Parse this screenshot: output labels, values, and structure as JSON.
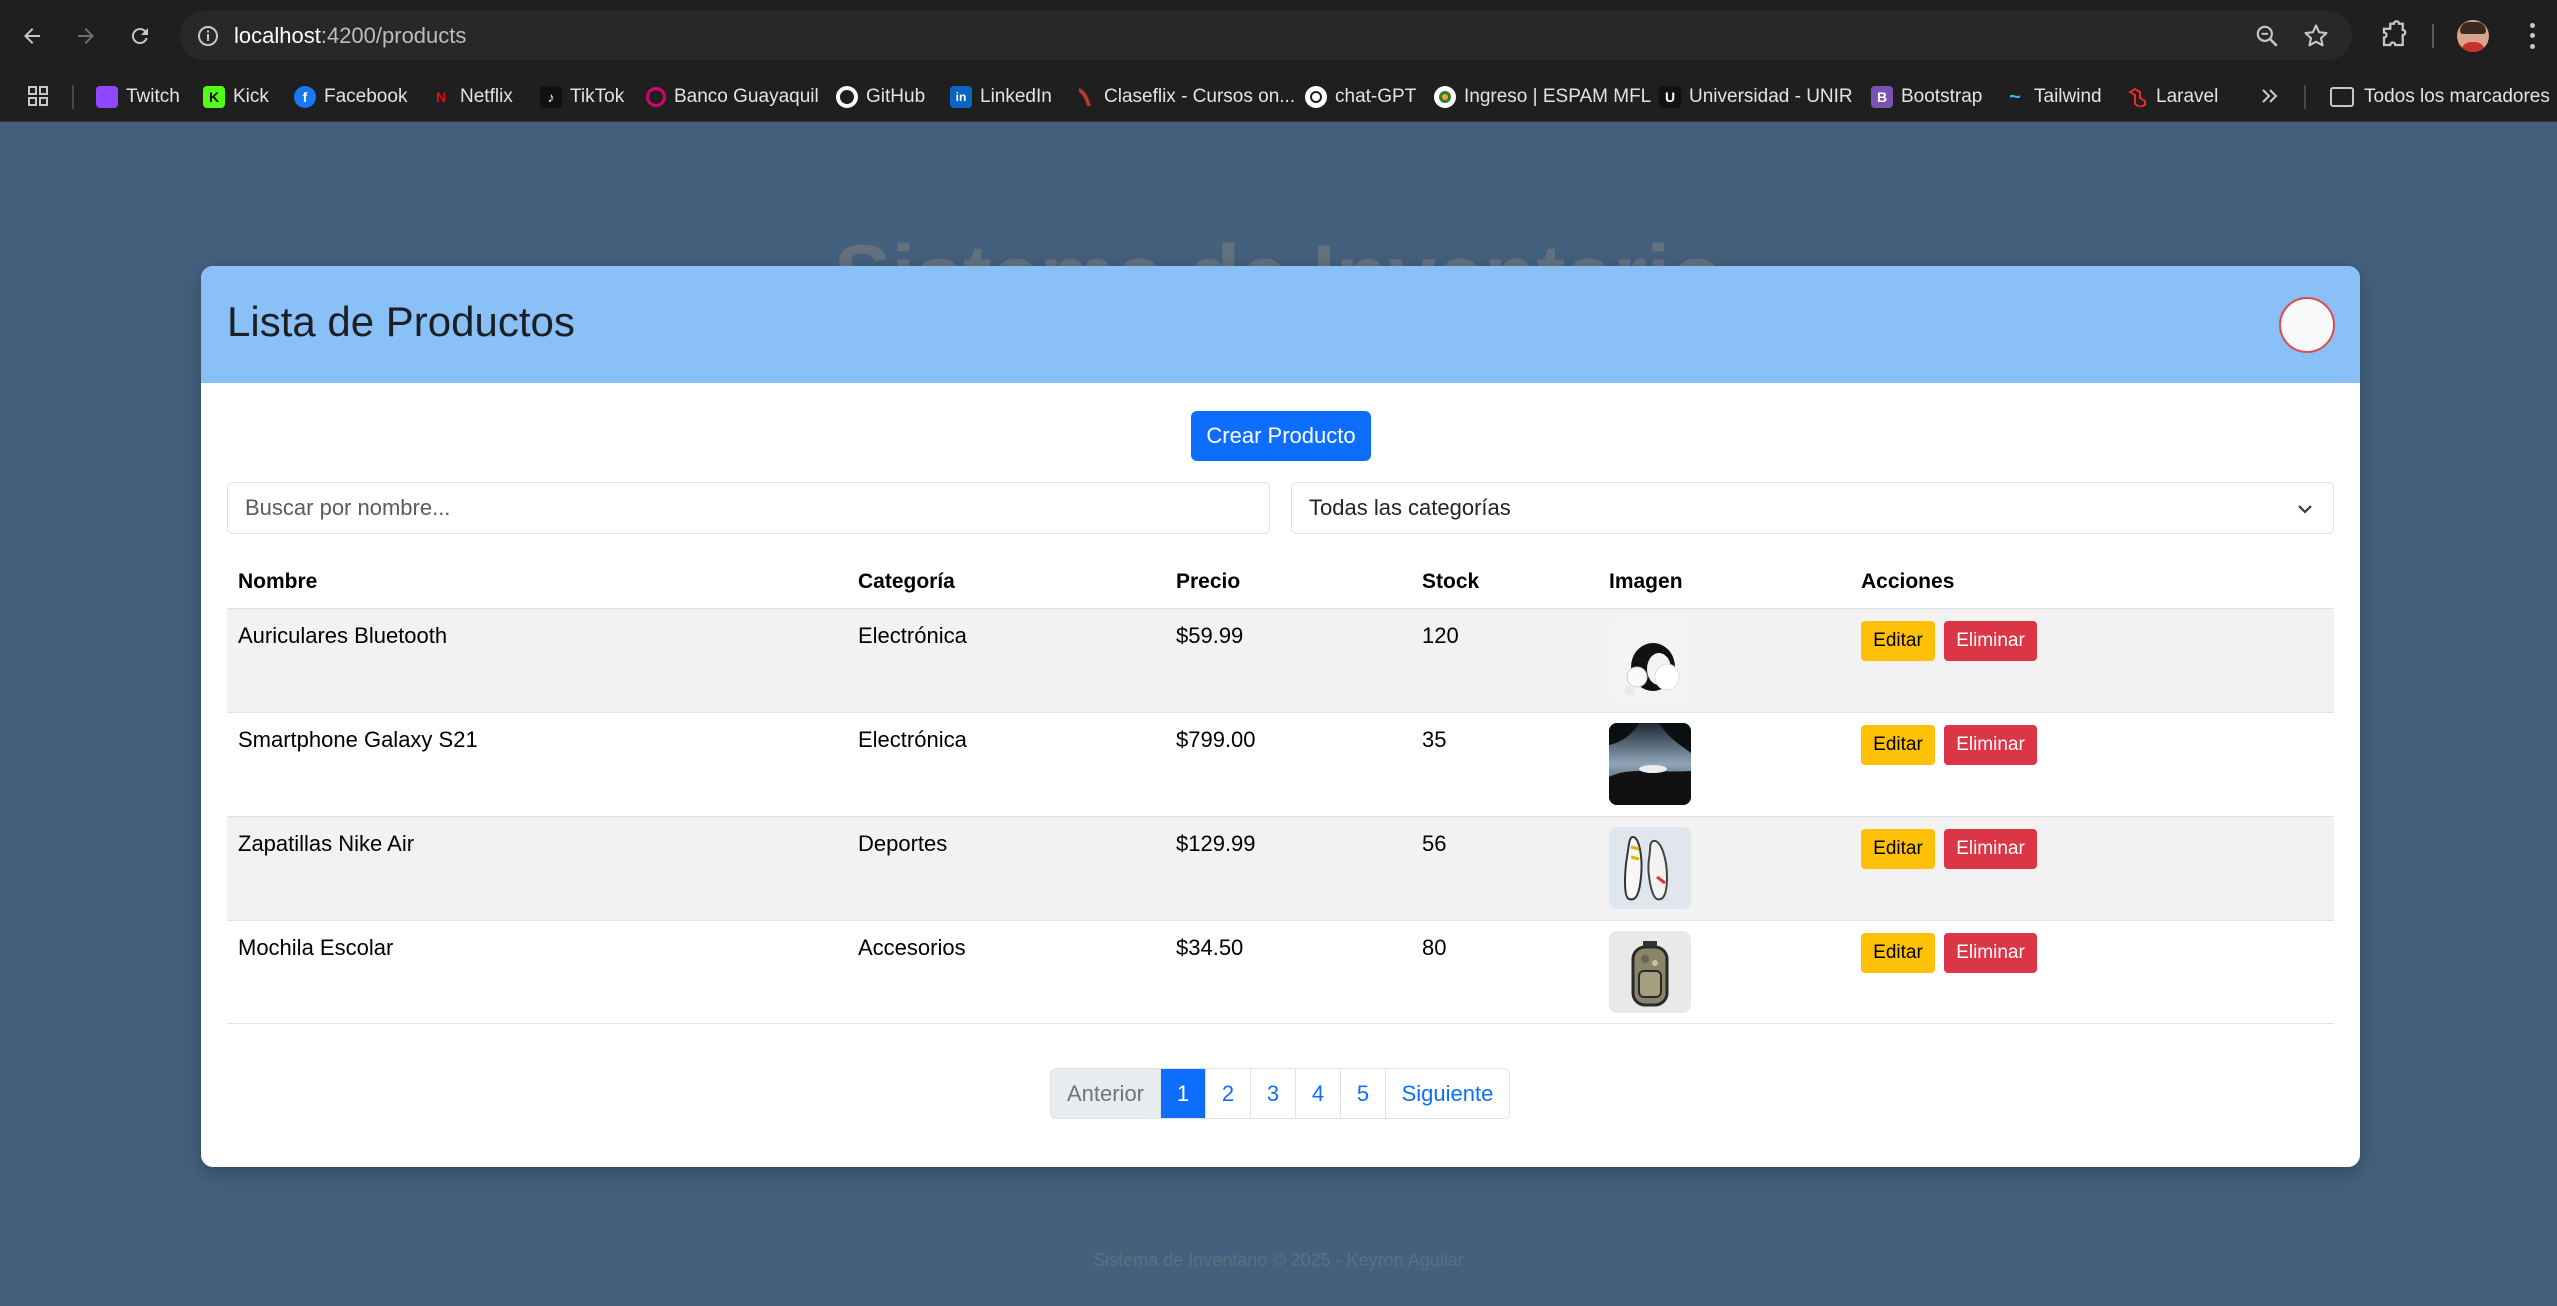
{
  "browser": {
    "url_host": "localhost",
    "url_path": ":4200/products",
    "bookmarks": [
      {
        "label": "Twitch",
        "color": "#9146ff",
        "glyph": ""
      },
      {
        "label": "Kick",
        "color": "#53fc18",
        "glyph": "K"
      },
      {
        "label": "Facebook",
        "color": "#1877f2",
        "glyph": "f"
      },
      {
        "label": "Netflix",
        "color": "#e50914",
        "glyph": "N"
      },
      {
        "label": "TikTok",
        "color": "#111111",
        "glyph": "♪"
      },
      {
        "label": "Banco Guayaquil",
        "color": "#d6006e",
        "glyph": "○"
      },
      {
        "label": "GitHub",
        "color": "#ffffff",
        "glyph": ""
      },
      {
        "label": "LinkedIn",
        "color": "#0a66c2",
        "glyph": "in"
      },
      {
        "label": "Claseflix - Cursos on...",
        "color": "#c0392b",
        "glyph": ""
      },
      {
        "label": "chat-GPT",
        "color": "#ffffff",
        "glyph": ""
      },
      {
        "label": "Ingreso | ESPAM MFL",
        "color": "#ffffff",
        "glyph": ""
      },
      {
        "label": "Universidad - UNIR",
        "color": "#111111",
        "glyph": "U"
      },
      {
        "label": "Bootstrap",
        "color": "#7952b3",
        "glyph": "B"
      },
      {
        "label": "Tailwind",
        "color": "#38bdf8",
        "glyph": "~"
      },
      {
        "label": "Laravel",
        "color": "#ff2d20",
        "glyph": ""
      }
    ],
    "all_bookmarks": "Todos los marcadores"
  },
  "page": {
    "background_title": "Sistema de Inventario",
    "card_title": "Lista de Productos",
    "create_button": "Crear Producto",
    "search_placeholder": "Buscar por nombre...",
    "category_selected": "Todas las categorías",
    "columns": [
      "Nombre",
      "Categoría",
      "Precio",
      "Stock",
      "Imagen",
      "Acciones"
    ],
    "edit_label": "Editar",
    "delete_label": "Eliminar",
    "products": [
      {
        "name": "Auriculares Bluetooth",
        "category": "Electrónica",
        "price": "$59.99",
        "stock": "120",
        "image": "headphones"
      },
      {
        "name": "Smartphone Galaxy S21",
        "category": "Electrónica",
        "price": "$799.00",
        "stock": "35",
        "image": "landscape"
      },
      {
        "name": "Zapatillas Nike Air",
        "category": "Deportes",
        "price": "$129.99",
        "stock": "56",
        "image": "sneakers"
      },
      {
        "name": "Mochila Escolar",
        "category": "Accesorios",
        "price": "$34.50",
        "stock": "80",
        "image": "backpack"
      }
    ],
    "pagination": {
      "prev": "Anterior",
      "pages": [
        "1",
        "2",
        "3",
        "4",
        "5"
      ],
      "active": "1",
      "next": "Siguiente"
    },
    "footer": "Sistema de Inventario © 2025 - Keyron Aguilar"
  },
  "colors": {
    "page_bg": "#44607d",
    "header_bg": "#89c0f8",
    "primary": "#0d6efd",
    "warning": "#ffc107",
    "danger": "#dc3545"
  }
}
